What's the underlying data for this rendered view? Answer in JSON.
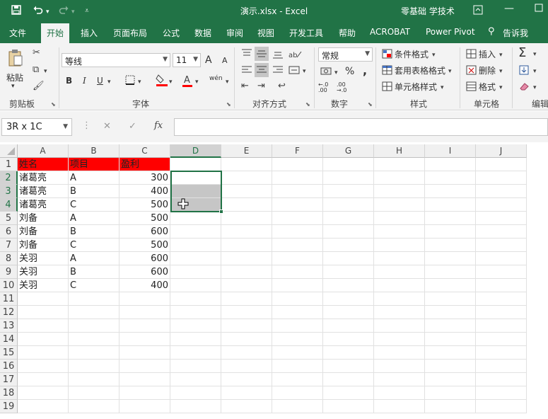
{
  "titlebar": {
    "doc_title": "演示.xlsx  -  Excel",
    "user": "零基础 学技术",
    "save_icon": "save-icon",
    "undo_icon": "undo-icon",
    "redo_icon": "redo-icon",
    "customize_icon": "chevron-down-icon"
  },
  "tabs": [
    "文件",
    "开始",
    "插入",
    "页面布局",
    "公式",
    "数据",
    "审阅",
    "视图",
    "开发工具",
    "帮助",
    "ACROBAT",
    "Power Pivot"
  ],
  "tell_me": "告诉我",
  "ribbon": {
    "clipboard": {
      "label": "剪贴板",
      "paste": "粘贴"
    },
    "font": {
      "label": "字体",
      "font_name": "等线",
      "font_size": "11",
      "bold": "B",
      "italic": "I",
      "underline": "U",
      "font_grow": "A",
      "font_shrink": "A",
      "phonetic": "wén"
    },
    "alignment": {
      "label": "对齐方式"
    },
    "number": {
      "label": "数字",
      "format": "常规",
      "percent": "%",
      "comma": ",",
      "inc_decimal": "←.0 .00",
      "dec_decimal": ".00 →.0"
    },
    "styles": {
      "label": "样式",
      "cond_format": "条件格式",
      "table_format": "套用表格格式",
      "cell_styles": "单元格样式"
    },
    "cells": {
      "label": "单元格",
      "insert": "插入",
      "delete": "删除",
      "format": "格式"
    },
    "editing": {
      "label": "编辑",
      "sum": "Σ"
    }
  },
  "formula_bar": {
    "name_box": "3R x 1C",
    "cancel": "✕",
    "enter": "✓",
    "fx": "fx",
    "value": ""
  },
  "columns": [
    "A",
    "B",
    "C",
    "D",
    "E",
    "F",
    "G",
    "H",
    "I",
    "J"
  ],
  "rows": [
    "1",
    "2",
    "3",
    "4",
    "5",
    "6",
    "7",
    "8",
    "9",
    "10",
    "11",
    "12",
    "13",
    "14",
    "15",
    "16",
    "17",
    "18",
    "19"
  ],
  "sheet": {
    "headers": [
      "姓名",
      "项目",
      "盈利"
    ],
    "records": [
      [
        "诸葛亮",
        "A",
        "300"
      ],
      [
        "诸葛亮",
        "B",
        "400"
      ],
      [
        "诸葛亮",
        "C",
        "500"
      ],
      [
        "刘备",
        "A",
        "500"
      ],
      [
        "刘备",
        "B",
        "600"
      ],
      [
        "刘备",
        "C",
        "500"
      ],
      [
        "关羽",
        "A",
        "600"
      ],
      [
        "关羽",
        "B",
        "600"
      ],
      [
        "关羽",
        "C",
        "400"
      ]
    ]
  },
  "selection": {
    "range": "D2:D4"
  },
  "colors": {
    "excel_green": "#217346",
    "header_fill": "#ff0000",
    "selection_border": "#217346"
  }
}
